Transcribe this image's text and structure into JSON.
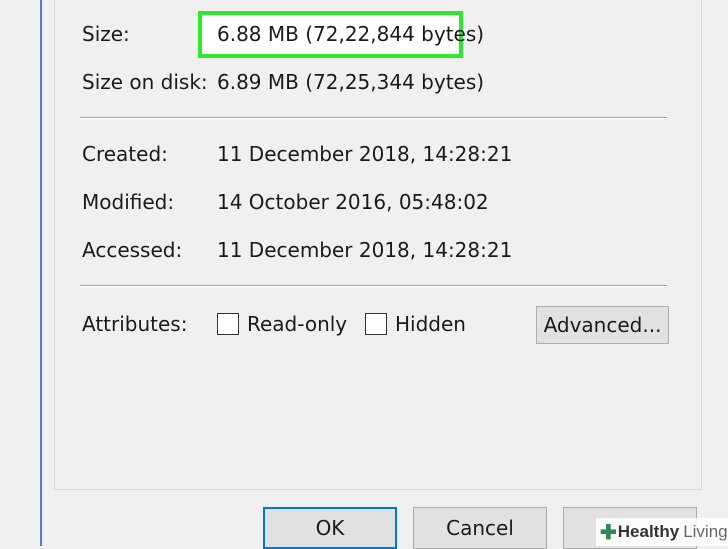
{
  "details": {
    "size": {
      "label": "Size:",
      "value": "6.88 MB (72,22,844 bytes)"
    },
    "size_on_disk": {
      "label": "Size on disk:",
      "value": "6.89 MB (72,25,344 bytes)"
    },
    "created": {
      "label": "Created:",
      "value": "11 December 2018, 14:28:21"
    },
    "modified": {
      "label": "Modified:",
      "value": "14 October 2016, 05:48:02"
    },
    "accessed": {
      "label": "Accessed:",
      "value": "11 December 2018, 14:28:21"
    }
  },
  "attributes": {
    "label": "Attributes:",
    "read_only": {
      "label": "Read-only",
      "checked": false
    },
    "hidden": {
      "label": "Hidden",
      "checked": false
    },
    "advanced_label": "Advanced..."
  },
  "buttons": {
    "ok": "OK",
    "cancel": "Cancel"
  },
  "watermark": {
    "brand": "Healthy",
    "suffix": "Living"
  },
  "colors": {
    "highlight": "#2ee82e",
    "primary_border": "#0078d7"
  }
}
